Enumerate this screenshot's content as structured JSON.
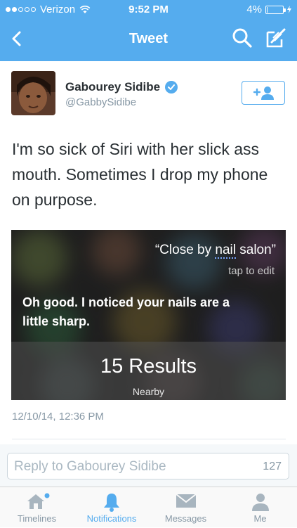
{
  "status_bar": {
    "carrier": "Verizon",
    "time": "9:52 PM",
    "battery": "4%",
    "battery_level": 0.04
  },
  "nav": {
    "title": "Tweet",
    "back_icon": "chevron-left-icon",
    "search_icon": "search-icon",
    "compose_icon": "compose-icon"
  },
  "tweet": {
    "author_name": "Gabourey Sidibe",
    "author_handle": "@GabbySidibe",
    "verified": true,
    "follow_button_label": "+",
    "text": "I'm so sick of Siri with her slick ass mouth. Sometimes I drop my phone on purpose.",
    "timestamp": "12/10/14, 12:36 PM"
  },
  "media": {
    "query_prefix": "“Close by ",
    "query_underlined": "nail",
    "query_suffix": " salon”",
    "tap_to_edit": "tap to edit",
    "siri_reply": "Oh good. I noticed your nails are a little sharp.",
    "results": "15 Results",
    "results_sub": "Nearby"
  },
  "reply": {
    "placeholder": "Reply to Gabourey Sidibe",
    "char_count": "127"
  },
  "tabbar": {
    "items": [
      {
        "label": "Timelines",
        "icon": "home-icon"
      },
      {
        "label": "Notifications",
        "icon": "bell-icon"
      },
      {
        "label": "Messages",
        "icon": "envelope-icon"
      },
      {
        "label": "Me",
        "icon": "person-icon"
      }
    ],
    "active": "Notifications"
  },
  "colors": {
    "brand": "#55acee",
    "text": "#292f33",
    "muted": "#8899a6"
  }
}
